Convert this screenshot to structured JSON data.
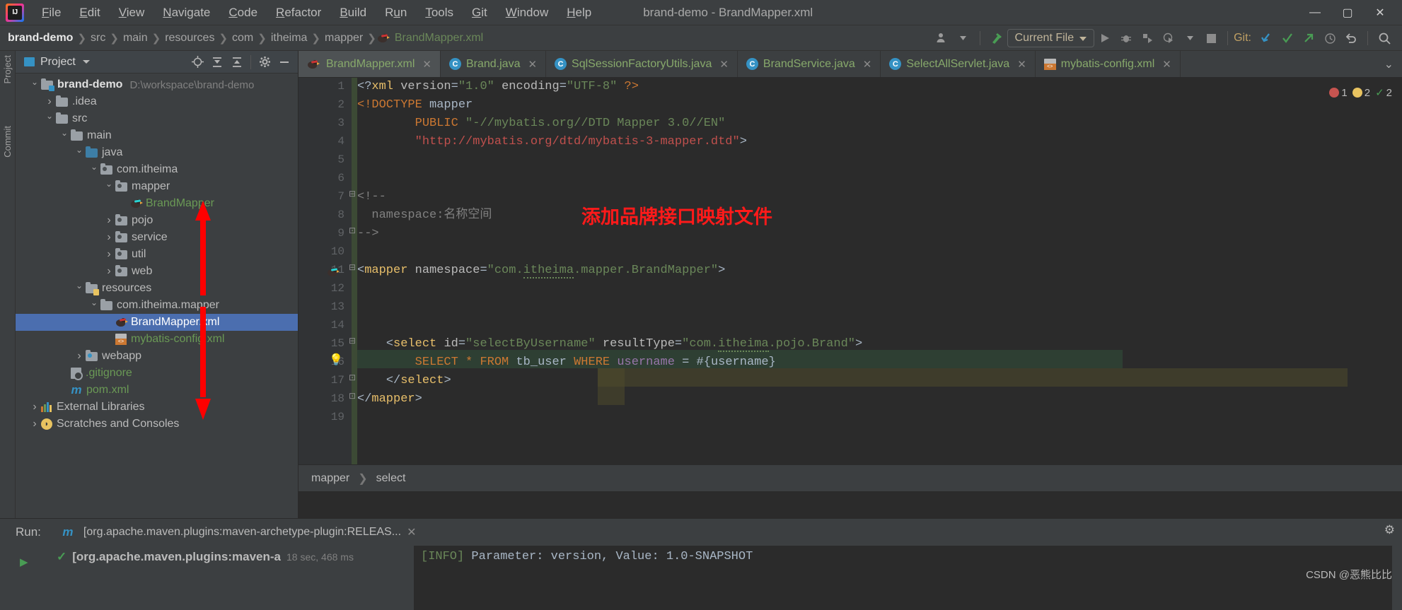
{
  "window": {
    "title": "brand-demo - BrandMapper.xml",
    "minimize": "—",
    "maximize": "▢",
    "close": "✕"
  },
  "menu": [
    {
      "label": "File",
      "mnemonic": "F"
    },
    {
      "label": "Edit",
      "mnemonic": "E"
    },
    {
      "label": "View",
      "mnemonic": "V"
    },
    {
      "label": "Navigate",
      "mnemonic": "N"
    },
    {
      "label": "Code",
      "mnemonic": "C"
    },
    {
      "label": "Refactor",
      "mnemonic": "R"
    },
    {
      "label": "Build",
      "mnemonic": "B"
    },
    {
      "label": "Run",
      "mnemonic": "u"
    },
    {
      "label": "Tools",
      "mnemonic": "T"
    },
    {
      "label": "Git",
      "mnemonic": "G"
    },
    {
      "label": "Window",
      "mnemonic": "W"
    },
    {
      "label": "Help",
      "mnemonic": "H"
    }
  ],
  "breadcrumbs": [
    "brand-demo",
    "src",
    "main",
    "resources",
    "com",
    "itheima",
    "mapper",
    "BrandMapper.xml"
  ],
  "toolbar": {
    "run_config": "Current File",
    "git_label": "Git:",
    "icons": [
      "user-avatar-icon",
      "hammer-build-icon",
      "run-icon",
      "debug-icon",
      "run-with-coverage-icon",
      "profiler-icon",
      "stop-icon",
      "git-update-icon",
      "git-commit-icon",
      "git-push-icon",
      "history-icon",
      "revert-icon",
      "search-everywhere-icon"
    ]
  },
  "stripes": [
    "Project",
    "Commit"
  ],
  "project_panel": {
    "title": "Project",
    "header_icons": [
      "locate-icon",
      "expand-all-icon",
      "collapse-all-icon",
      "settings-icon",
      "hide-icon"
    ],
    "tree": [
      {
        "indent": 0,
        "arrow": "down",
        "icon": "module-folder",
        "label": "brand-demo",
        "style": "bold",
        "path": "D:\\workspace\\brand-demo"
      },
      {
        "indent": 1,
        "arrow": "right",
        "icon": "folder",
        "label": ".idea",
        "style": "plain"
      },
      {
        "indent": 1,
        "arrow": "down",
        "icon": "folder",
        "label": "src",
        "style": "plain"
      },
      {
        "indent": 2,
        "arrow": "down",
        "icon": "folder",
        "label": "main",
        "style": "plain"
      },
      {
        "indent": 3,
        "arrow": "down",
        "icon": "source-folder",
        "label": "java",
        "style": "plain"
      },
      {
        "indent": 4,
        "arrow": "down",
        "icon": "package",
        "label": "com.itheima",
        "style": "plain"
      },
      {
        "indent": 5,
        "arrow": "down",
        "icon": "package",
        "label": "mapper",
        "style": "plain"
      },
      {
        "indent": 6,
        "arrow": "none",
        "icon": "mybatis-bird-cyan",
        "label": "BrandMapper",
        "style": "green"
      },
      {
        "indent": 5,
        "arrow": "right",
        "icon": "package",
        "label": "pojo",
        "style": "plain"
      },
      {
        "indent": 5,
        "arrow": "right",
        "icon": "package",
        "label": "service",
        "style": "plain"
      },
      {
        "indent": 5,
        "arrow": "right",
        "icon": "package",
        "label": "util",
        "style": "plain"
      },
      {
        "indent": 5,
        "arrow": "right",
        "icon": "package",
        "label": "web",
        "style": "plain"
      },
      {
        "indent": 3,
        "arrow": "down",
        "icon": "resources-folder",
        "label": "resources",
        "style": "plain"
      },
      {
        "indent": 4,
        "arrow": "down",
        "icon": "folder",
        "label": "com.itheima.mapper",
        "style": "plain"
      },
      {
        "indent": 5,
        "arrow": "none",
        "icon": "mybatis-bird",
        "label": "BrandMapper.xml",
        "style": "selected"
      },
      {
        "indent": 5,
        "arrow": "none",
        "icon": "xml-file",
        "label": "mybatis-config.xml",
        "style": "green"
      },
      {
        "indent": 3,
        "arrow": "right",
        "icon": "web-folder",
        "label": "webapp",
        "style": "plain"
      },
      {
        "indent": 2,
        "arrow": "none",
        "icon": "gitignore-file",
        "label": ".gitignore",
        "style": "green"
      },
      {
        "indent": 2,
        "arrow": "none",
        "icon": "maven-m",
        "label": "pom.xml",
        "style": "green"
      },
      {
        "indent": 0,
        "arrow": "right",
        "icon": "libraries",
        "label": "External Libraries",
        "style": "plain"
      },
      {
        "indent": 0,
        "arrow": "right",
        "icon": "scratches",
        "label": "Scratches and Consoles",
        "style": "plain"
      }
    ]
  },
  "editor_tabs": [
    {
      "label": "BrandMapper.xml",
      "icon": "mybatis-bird",
      "active": true
    },
    {
      "label": "Brand.java",
      "icon": "class-icon",
      "active": false
    },
    {
      "label": "SqlSessionFactoryUtils.java",
      "icon": "class-icon",
      "active": false
    },
    {
      "label": "BrandService.java",
      "icon": "class-icon",
      "active": false
    },
    {
      "label": "SelectAllServlet.java",
      "icon": "class-icon",
      "active": false
    },
    {
      "label": "mybatis-config.xml",
      "icon": "xml-file",
      "active": false
    }
  ],
  "editor": {
    "line_numbers": [
      "1",
      "2",
      "3",
      "4",
      "5",
      "6",
      "7",
      "8",
      "9",
      "10",
      "11",
      "12",
      "13",
      "14",
      "15",
      "16",
      "17",
      "18",
      "19"
    ],
    "code_lines": [
      {
        "n": 1,
        "text": "<?xml version=\"1.0\" encoding=\"UTF-8\" ?>"
      },
      {
        "n": 2,
        "text": "<!DOCTYPE mapper"
      },
      {
        "n": 3,
        "text": "        PUBLIC \"-//mybatis.org//DTD Mapper 3.0//EN\""
      },
      {
        "n": 4,
        "text": "        \"http://mybatis.org/dtd/mybatis-3-mapper.dtd\">"
      },
      {
        "n": 5,
        "text": ""
      },
      {
        "n": 6,
        "text": ""
      },
      {
        "n": 7,
        "text": "<!--"
      },
      {
        "n": 8,
        "text": "  namespace:名称空间"
      },
      {
        "n": 9,
        "text": "-->"
      },
      {
        "n": 10,
        "text": ""
      },
      {
        "n": 11,
        "text": "<mapper namespace=\"com.itheima.mapper.BrandMapper\">"
      },
      {
        "n": 12,
        "text": ""
      },
      {
        "n": 13,
        "text": ""
      },
      {
        "n": 14,
        "text": ""
      },
      {
        "n": 15,
        "text": "    <select id=\"selectByUsername\" resultType=\"com.itheima.pojo.Brand\">"
      },
      {
        "n": 16,
        "text": "        SELECT * FROM tb_user WHERE username = #{username}"
      },
      {
        "n": 17,
        "text": "    </select>"
      },
      {
        "n": 18,
        "text": "</mapper>"
      },
      {
        "n": 19,
        "text": ""
      }
    ],
    "annotation": "添加品牌接口映射文件",
    "annotation_color": "#ff1a1a",
    "inspections": {
      "errors": "1",
      "warnings": "2",
      "ok": "2"
    },
    "breadcrumb": [
      "mapper",
      "select"
    ]
  },
  "run_panel": {
    "label": "Run:",
    "tab_title": "[org.apache.maven.plugins:maven-archetype-plugin:RELEAS...",
    "item_title": "[org.apache.maven.plugins:maven-a",
    "item_time": "18 sec, 468 ms",
    "console_line": "[INFO] Parameter: version, Value: 1.0-SNAPSHOT",
    "console_tag": "[INFO]"
  },
  "watermark": "CSDN @恶熊比比",
  "colors": {
    "accent_blue": "#4b6eaf",
    "string_green": "#6a8759",
    "tag_yellow": "#e8bf6a",
    "keyword_orange": "#cc7832",
    "annotation_red": "#ff1a1a",
    "editor_bg": "#2b2b2b",
    "panel_bg": "#3c3f41"
  }
}
